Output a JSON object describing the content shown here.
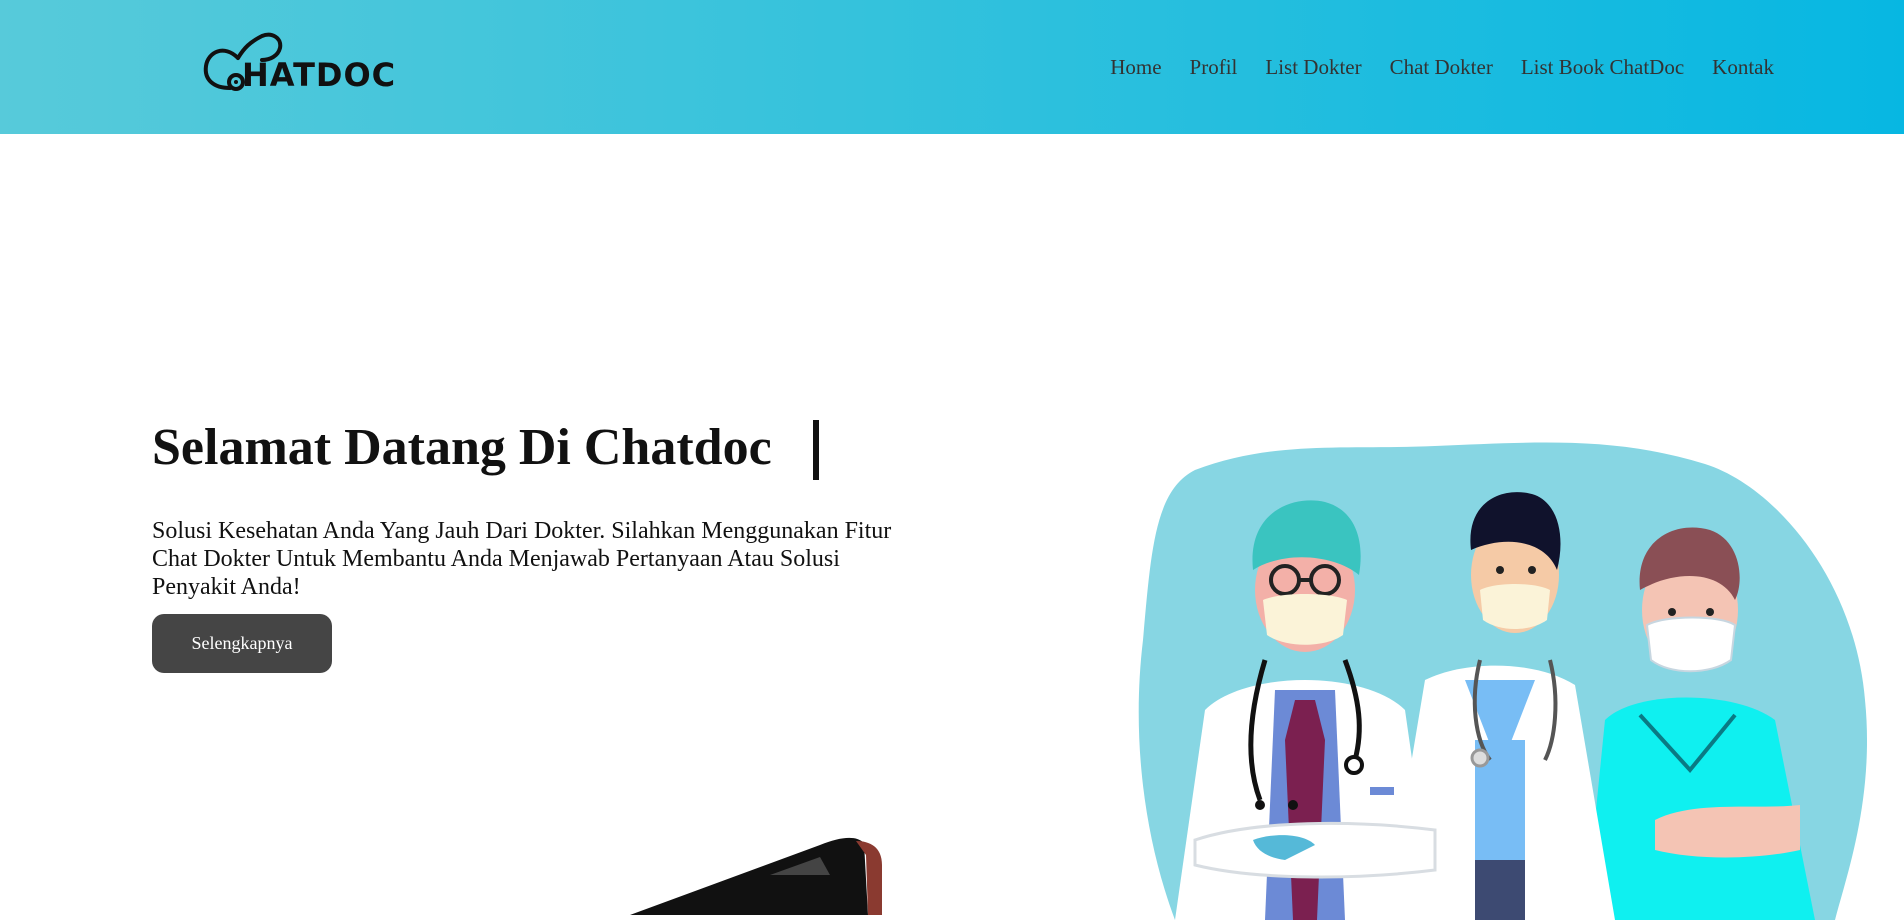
{
  "header": {
    "logo_text": "HATDOC",
    "nav": [
      "Home",
      "Profil",
      "List Dokter",
      "Chat Dokter",
      "List Book ChatDoc",
      "Kontak"
    ]
  },
  "hero": {
    "title": "Selamat Datang Di Chatdoc",
    "description": "Solusi Kesehatan Anda Yang Jauh Dari Dokter. Silahkan Menggunakan Fitur Chat Dokter Untuk Membantu Anda Menjawab Pertanyaan Atau Solusi Penyakit Anda!",
    "cta_label": "Selengkapnya"
  },
  "colors": {
    "header_start": "#57cada",
    "header_end": "#07b7e2",
    "button": "#454545",
    "blob": "#87d6e3"
  }
}
